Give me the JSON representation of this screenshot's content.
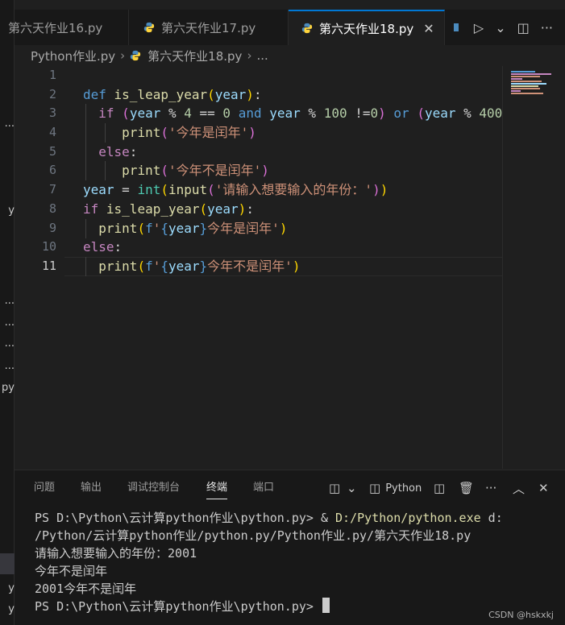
{
  "left_strip": {
    "items": [
      "...",
      "y",
      "...",
      "...",
      "...",
      "...",
      "py",
      "y",
      "y"
    ]
  },
  "tabs": [
    {
      "label": "第六天作业16.py",
      "state": "partial"
    },
    {
      "label": "第六天作业17.py",
      "state": "inactive"
    },
    {
      "label": "第六天作业18.py",
      "state": "active",
      "close": "✕"
    }
  ],
  "tab_actions": {
    "run": "▷",
    "run_dropdown": "⌄",
    "split": "◫",
    "more": "···"
  },
  "breadcrumb": {
    "folder": "Python作业.py",
    "file": "第六天作业18.py",
    "ellipsis": "..."
  },
  "editor": {
    "line_numbers": [
      "1",
      "2",
      "3",
      "4",
      "5",
      "6",
      "7",
      "8",
      "9",
      "10",
      "11"
    ],
    "current_line": 11,
    "lines": [
      [],
      [
        [
          "kw",
          "def "
        ],
        [
          "fn",
          "is_leap_year"
        ],
        [
          "p1",
          "("
        ],
        [
          "var",
          "year"
        ],
        [
          "p1",
          ")"
        ],
        [
          "op",
          ":"
        ]
      ],
      [
        [
          "op",
          "  "
        ],
        [
          "ctrl",
          "if "
        ],
        [
          "p2",
          "("
        ],
        [
          "var",
          "year"
        ],
        [
          "op",
          " % "
        ],
        [
          "num",
          "4"
        ],
        [
          "op",
          " == "
        ],
        [
          "num",
          "0"
        ],
        [
          "op",
          " "
        ],
        [
          "kw",
          "and"
        ],
        [
          "op",
          " "
        ],
        [
          "var",
          "year"
        ],
        [
          "op",
          " % "
        ],
        [
          "num",
          "100"
        ],
        [
          "op",
          " !="
        ],
        [
          "num",
          "0"
        ],
        [
          "p2",
          ")"
        ],
        [
          "op",
          " "
        ],
        [
          "kw",
          "or"
        ],
        [
          "op",
          " "
        ],
        [
          "p2",
          "("
        ],
        [
          "var",
          "year"
        ],
        [
          "op",
          " % "
        ],
        [
          "num",
          "400"
        ]
      ],
      [
        [
          "op",
          "     "
        ],
        [
          "fn",
          "print"
        ],
        [
          "p2",
          "("
        ],
        [
          "str",
          "'今年是闰年'"
        ],
        [
          "p2",
          ")"
        ]
      ],
      [
        [
          "op",
          "  "
        ],
        [
          "ctrl",
          "else"
        ],
        [
          "op",
          ":"
        ]
      ],
      [
        [
          "op",
          "     "
        ],
        [
          "fn",
          "print"
        ],
        [
          "p2",
          "("
        ],
        [
          "str",
          "'今年不是闰年'"
        ],
        [
          "p2",
          ")"
        ]
      ],
      [
        [
          "var",
          "year"
        ],
        [
          "op",
          " = "
        ],
        [
          "bin",
          "int"
        ],
        [
          "p1",
          "("
        ],
        [
          "fn",
          "input"
        ],
        [
          "p2",
          "("
        ],
        [
          "str",
          "'请输入想要输入的年份：'"
        ],
        [
          "p2",
          ")"
        ],
        [
          "p1",
          ")"
        ]
      ],
      [
        [
          "ctrl",
          "if "
        ],
        [
          "fn",
          "is_leap_year"
        ],
        [
          "p1",
          "("
        ],
        [
          "var",
          "year"
        ],
        [
          "p1",
          ")"
        ],
        [
          "op",
          ":"
        ]
      ],
      [
        [
          "op",
          "  "
        ],
        [
          "fn",
          "print"
        ],
        [
          "p1",
          "("
        ],
        [
          "kw",
          "f"
        ],
        [
          "str",
          "'"
        ],
        [
          "kw",
          "{"
        ],
        [
          "var",
          "year"
        ],
        [
          "kw",
          "}"
        ],
        [
          "str",
          "今年是闰年'"
        ],
        [
          "p1",
          ")"
        ]
      ],
      [
        [
          "ctrl",
          "else"
        ],
        [
          "op",
          ":"
        ]
      ],
      [
        [
          "op",
          "  "
        ],
        [
          "fn",
          "print"
        ],
        [
          "p1",
          "("
        ],
        [
          "kw",
          "f"
        ],
        [
          "str",
          "'"
        ],
        [
          "kw",
          "{"
        ],
        [
          "var",
          "year"
        ],
        [
          "kw",
          "}"
        ],
        [
          "str",
          "今年不是闰年'"
        ],
        [
          "p1",
          ")"
        ]
      ]
    ]
  },
  "panel": {
    "tabs": [
      "问题",
      "输出",
      "调试控制台",
      "终端",
      "端口"
    ],
    "active_tab": "终端",
    "terminal_name": "Python",
    "actions": {
      "layout": "◫",
      "layout_dropdown": "⌄",
      "split": "◫",
      "trash": "🗑",
      "more": "···",
      "maximize": "︿",
      "close": "✕"
    }
  },
  "terminal": {
    "prompt_line_1": "PS D:\\Python\\云计算python作业\\python.py> & ",
    "exe_path": "D:/Python/python.exe",
    "cmd_rest": " d:",
    "line_2": "/Python/云计算python作业/python.py/Python作业.py/第六天作业18.py",
    "line_3": "请输入想要输入的年份：2001",
    "line_4": "今年不是闰年",
    "line_5": "2001今年不是闰年",
    "line_6": "PS D:\\Python\\云计算python作业\\python.py> "
  },
  "watermark": "CSDN @hskxkj",
  "colors": {
    "accent": "#0078d4",
    "background": "#1f1f1f",
    "panel": "#181818"
  }
}
